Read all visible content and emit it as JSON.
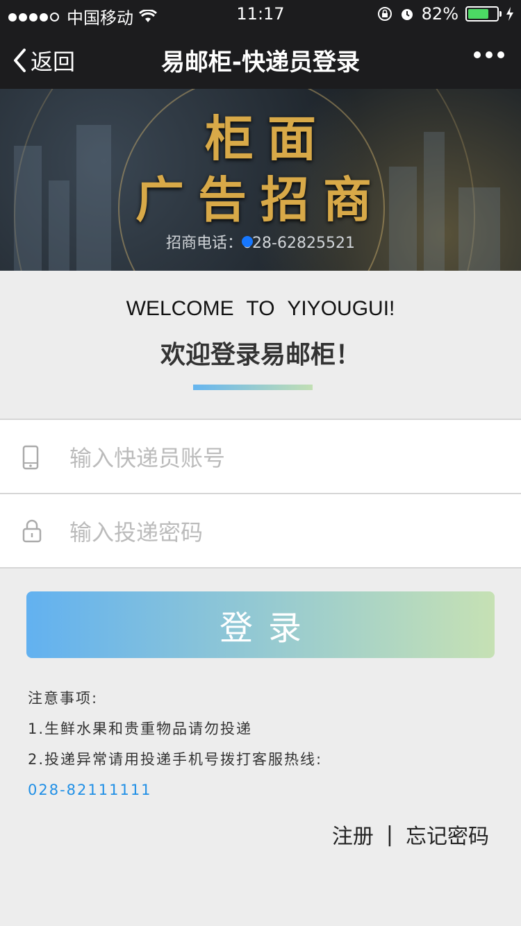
{
  "status_bar": {
    "carrier": "中国移动",
    "time": "11:17",
    "battery": "82%",
    "battery_level": 0.82
  },
  "nav": {
    "back_label": "返回",
    "title": "易邮柜-快递员登录"
  },
  "banner": {
    "line1": "柜面",
    "line2": "广告招商",
    "phone": "招商电话：028-62825521"
  },
  "welcome": {
    "en": "WELCOME TO YIYOUGUI!",
    "cn": "欢迎登录易邮柜！"
  },
  "form": {
    "account_placeholder": "输入快递员账号",
    "password_placeholder": "输入投递密码"
  },
  "login_label": "登录",
  "notes": {
    "title": "注意事项:",
    "item1": "1.生鲜水果和贵重物品请勿投递",
    "item2": "2.投递异常请用投递手机号拨打客服热线:",
    "hotline": "028-82111111"
  },
  "links": {
    "register": "注册",
    "separator": "|",
    "forgot": "忘记密码"
  },
  "colors": {
    "accent_start": "#62b1f0",
    "accent_end": "#c6e1b4",
    "hotline": "#1f8fe6",
    "nav_bg": "#1c1c1e"
  }
}
